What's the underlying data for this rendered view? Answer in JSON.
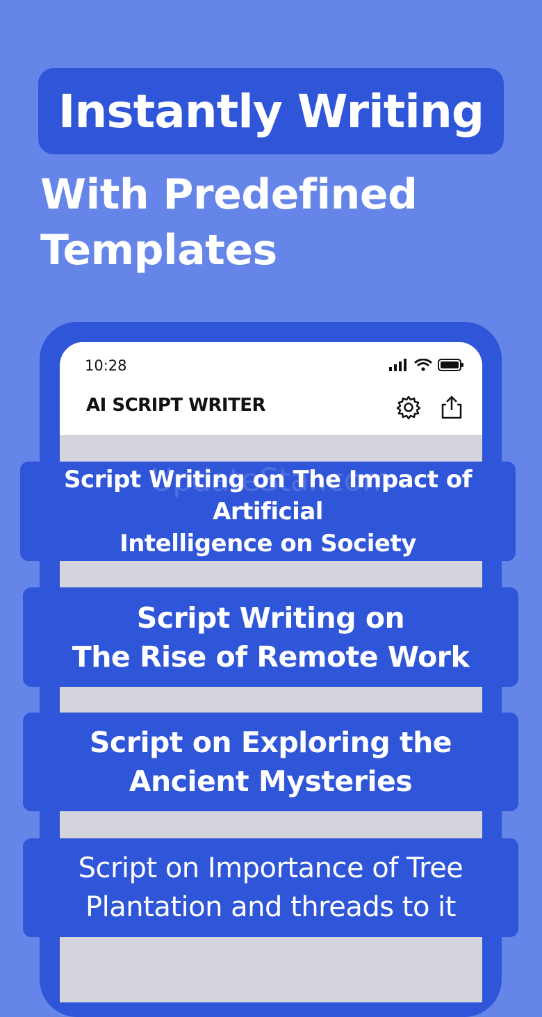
{
  "hero": {
    "title": "Instantly Writing",
    "subtitle": "With Predefined\nTemplates"
  },
  "status_bar": {
    "time": "10:28"
  },
  "app": {
    "title": "AI SCRIPT WRITER",
    "icons": [
      "gear-icon",
      "share-icon",
      "signal-icon",
      "wifi-icon",
      "battery-icon"
    ]
  },
  "templates": [
    {
      "label": "Script Writing on The Impact of Artificial\nIntelligence on Society"
    },
    {
      "label": "Script Writing on\nThe Rise of Remote Work"
    },
    {
      "label": "Script on Exploring the\nAncient Mysteries"
    },
    {
      "label": "Script on Importance of Tree\nPlantation and threads to it"
    }
  ],
  "watermark": "UpdateStar.com",
  "colors": {
    "background": "#6585e8",
    "accent": "#2f55d8",
    "screen": "#d4d4dd",
    "text": "#ffffff"
  }
}
